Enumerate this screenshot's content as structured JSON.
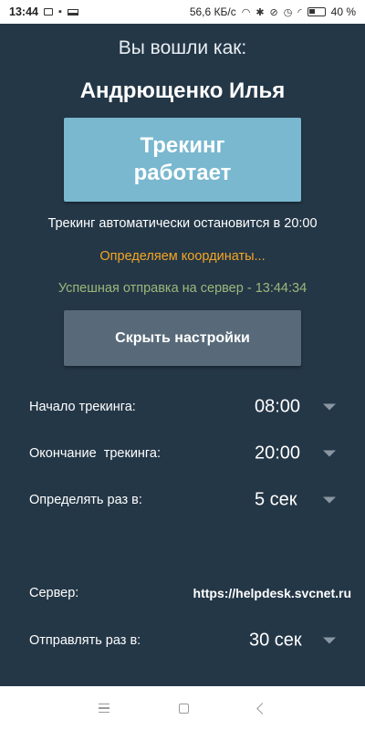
{
  "status_bar": {
    "time": "13:44",
    "network_speed": "56,6 КБ/с",
    "battery": "40 %"
  },
  "header": {
    "logged_in_label": "Вы вошли как:",
    "user_name": "Андрющенко Илья"
  },
  "tracking": {
    "button_label": "Трекинг\nработает",
    "auto_stop_text": "Трекинг автоматически остановится в 20:00",
    "coords_status": "Определяем координаты...",
    "send_status": "Успешная отправка на сервер - 13:44:34",
    "hide_settings_label": "Скрыть настройки"
  },
  "settings": {
    "start": {
      "label": "Начало трекинга:",
      "value": "08:00"
    },
    "end": {
      "label": "Окончание  трекинга:",
      "value": "20:00"
    },
    "interval": {
      "label": "Определять раз в:",
      "value": "5 сек"
    },
    "server": {
      "label": "Сервер:",
      "value": "https://helpdesk.svcnet.ru"
    },
    "send_interval": {
      "label": "Отправлять раз в:",
      "value": "30 сек"
    }
  },
  "colors": {
    "background": "#243747",
    "tracking_button": "#79b8cf",
    "secondary_button": "#586a7a",
    "status_orange": "#f5a623",
    "status_green": "#9bb87a"
  },
  "icons": {
    "nav": [
      "menu-icon",
      "home-icon",
      "back-icon"
    ]
  }
}
